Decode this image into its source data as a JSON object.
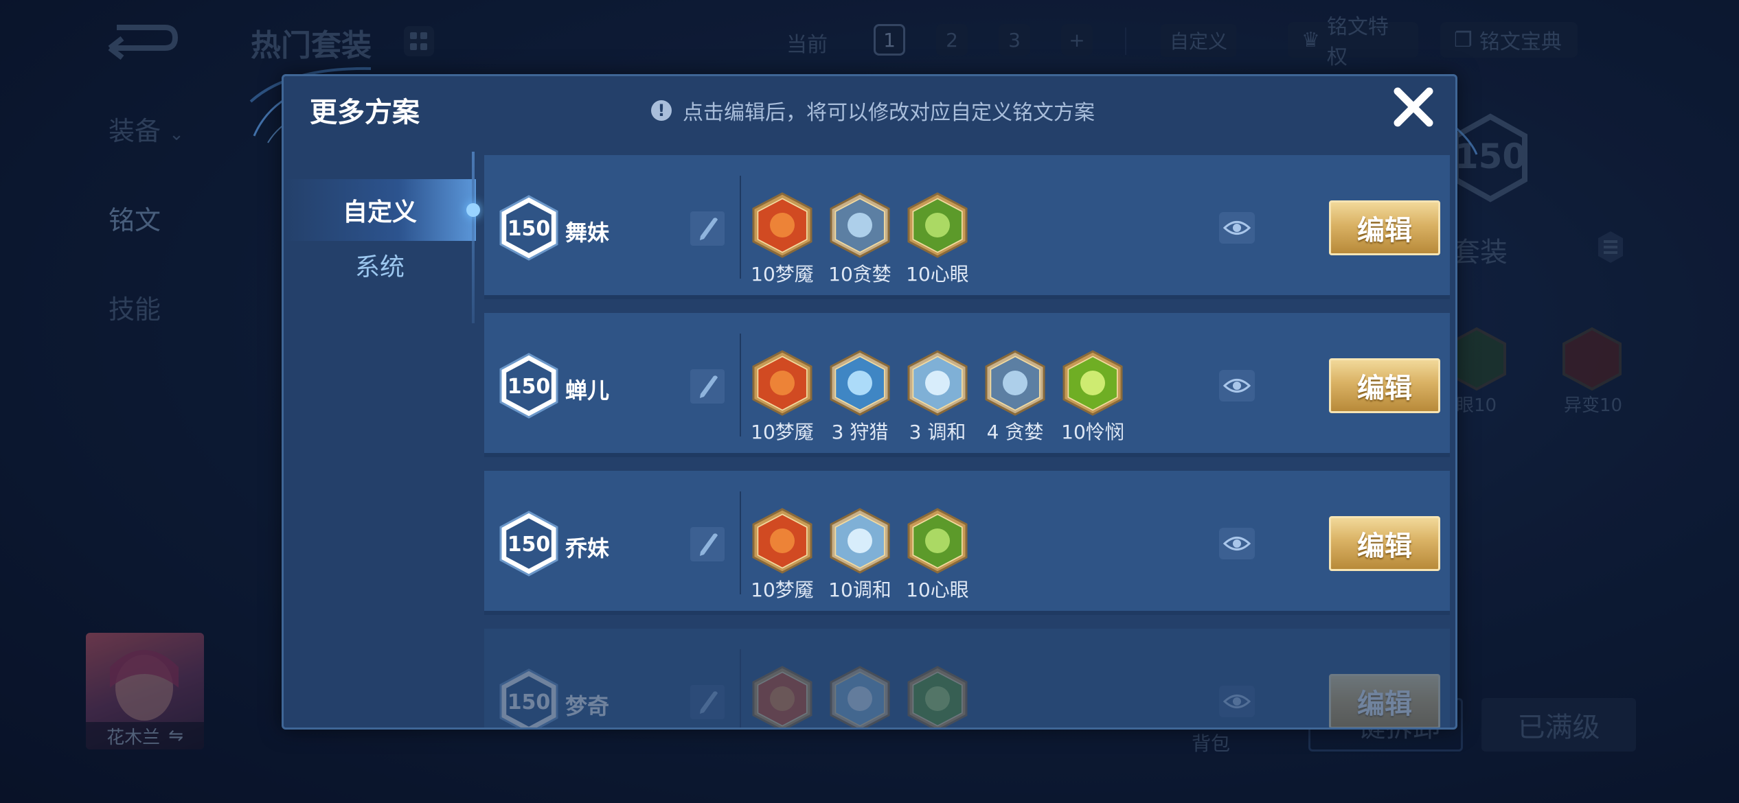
{
  "background": {
    "title": "热门套装",
    "current_label": "当前",
    "pages": [
      "1",
      "2",
      "3",
      "+"
    ],
    "active_page": "1",
    "custom_label": "自定义",
    "privilege_label": "铭文特权",
    "codex_label": "铭文宝典",
    "sidebar": [
      {
        "label": "装备"
      },
      {
        "label": "铭文"
      },
      {
        "label": "技能"
      }
    ],
    "set_level": "150",
    "set_label": "门套装",
    "runes": [
      {
        "label": "眼10"
      },
      {
        "label": "异变10"
      }
    ],
    "hero_name": "花木兰",
    "bag_label": "背包",
    "button_left": "一键拆卸",
    "button_right": "已满级"
  },
  "modal": {
    "title": "更多方案",
    "hint": "点击编辑后，将可以修改对应自定义铭文方案",
    "tabs": [
      {
        "label": "自定义",
        "active": true
      },
      {
        "label": "系统",
        "active": false
      }
    ],
    "edit_label": "编辑",
    "plans": [
      {
        "level": "150",
        "name": "舞妹",
        "runes": [
          {
            "icon": "dream-demon-rune-red",
            "label": "10梦魇"
          },
          {
            "icon": "greed-rune-blue",
            "label": "10贪婪"
          },
          {
            "icon": "heart-eye-rune-green",
            "label": "10心眼"
          }
        ]
      },
      {
        "level": "150",
        "name": "蝉儿",
        "runes": [
          {
            "icon": "dream-demon-rune-red",
            "label": "10梦魇"
          },
          {
            "icon": "hunt-rune-blue",
            "label": "3 狩猎"
          },
          {
            "icon": "harmony-rune-blue",
            "label": "3 调和"
          },
          {
            "icon": "greed-rune-blue",
            "label": "4 贪婪"
          },
          {
            "icon": "mercy-rune-green",
            "label": "10怜悯"
          }
        ]
      },
      {
        "level": "150",
        "name": "乔妹",
        "runes": [
          {
            "icon": "dream-demon-rune-red",
            "label": "10梦魇"
          },
          {
            "icon": "harmony-rune-blue",
            "label": "10调和"
          },
          {
            "icon": "heart-eye-rune-green",
            "label": "10心眼"
          }
        ]
      },
      {
        "level": "150",
        "name": "梦奇",
        "runes": [
          {
            "icon": "dream-demon-rune-red",
            "label": ""
          },
          {
            "icon": "harmony-rune-blue",
            "label": ""
          },
          {
            "icon": "heart-eye-rune-green",
            "label": ""
          }
        ]
      }
    ]
  },
  "colors": {
    "modal_bg": "#24406a",
    "row_bg": "#2f5486",
    "edit_gold": "#d9b163",
    "rune_red": "#d9532b",
    "rune_blue": "#8fc3e8",
    "rune_green": "#7fbf3a"
  }
}
